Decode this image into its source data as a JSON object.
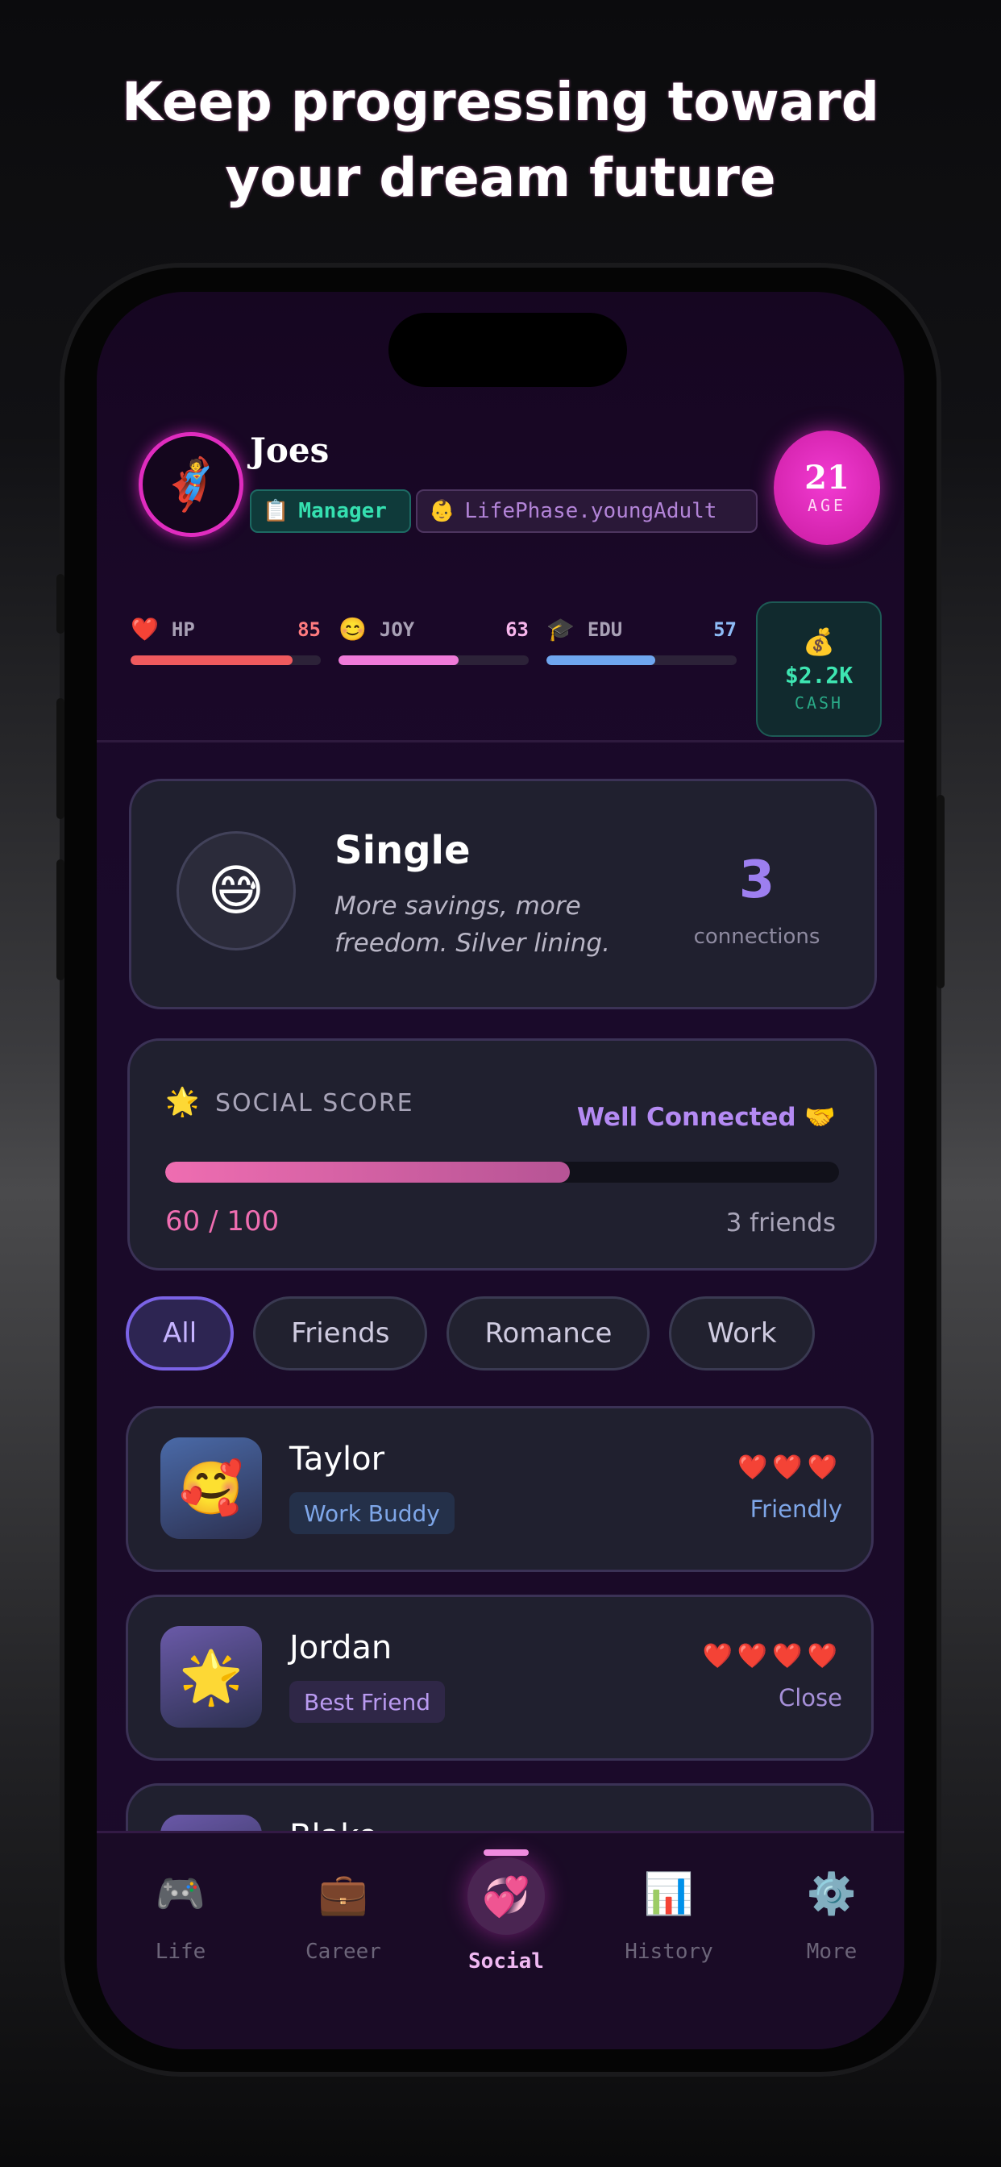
{
  "headline": {
    "line1": "Keep progressing toward",
    "line2": "your dream future"
  },
  "profile": {
    "name": "Joes",
    "avatar": "🦸",
    "job_icon": "📋",
    "job": "Manager",
    "phase_icon": "👶",
    "phase": "LifePhase.youngAdult",
    "age": "21",
    "age_label": "AGE"
  },
  "stats": [
    {
      "icon": "❤️",
      "name": "HP",
      "value": "85",
      "fill": 0.85,
      "color": "#ef5a5e",
      "val_color": "#ff7b7f"
    },
    {
      "icon": "😊",
      "name": "JOY",
      "value": "63",
      "fill": 0.63,
      "color": "#ef7ad9",
      "val_color": "#f7b6ec"
    },
    {
      "icon": "🎓",
      "name": "EDU",
      "value": "57",
      "fill": 0.57,
      "color": "#6fa6ef",
      "val_color": "#8ebcf7"
    }
  ],
  "cash": {
    "icon": "💰",
    "value": "$2.2K",
    "label": "CASH"
  },
  "status": {
    "emoji": "😅",
    "title": "Single",
    "subtitle": "More savings, more freedom. Silver lining.",
    "connections": "3",
    "connections_label": "connections"
  },
  "social_score": {
    "icon": "🌟",
    "title": "SOCIAL SCORE",
    "rating": "Well Connected 🤝",
    "score_text": "60 / 100",
    "fill": 0.6,
    "friends": "3 friends"
  },
  "filters": [
    "All",
    "Friends",
    "Romance",
    "Work"
  ],
  "people": [
    {
      "emoji": "🥰",
      "name": "Taylor",
      "tag": "Work Buddy",
      "hearts": "❤️❤️❤️",
      "level": "Friendly",
      "avatar_bg": "#4a6aa8",
      "tag_bg": "#243049",
      "tag_color": "#7ea6e8",
      "level_color": "#7ea6e8"
    },
    {
      "emoji": "🌟",
      "name": "Jordan",
      "tag": "Best Friend",
      "hearts": "❤️❤️❤️❤️",
      "level": "Close",
      "avatar_bg": "#6a5aa8",
      "tag_bg": "#2f2747",
      "tag_color": "#b99af0",
      "level_color": "#a690d8"
    },
    {
      "emoji": "😊",
      "name": "Blake",
      "tag": "",
      "hearts": "❤️❤️❤️",
      "level": "",
      "avatar_bg": "#6a58a8",
      "tag_bg": "#2f2747",
      "tag_color": "#b99af0",
      "level_color": "#a690d8"
    }
  ],
  "nav": [
    {
      "icon": "🎮",
      "label": "Life"
    },
    {
      "icon": "💼",
      "label": "Career"
    },
    {
      "icon": "💞",
      "label": "Social"
    },
    {
      "icon": "📊",
      "label": "History"
    },
    {
      "icon": "⚙️",
      "label": "More"
    }
  ]
}
